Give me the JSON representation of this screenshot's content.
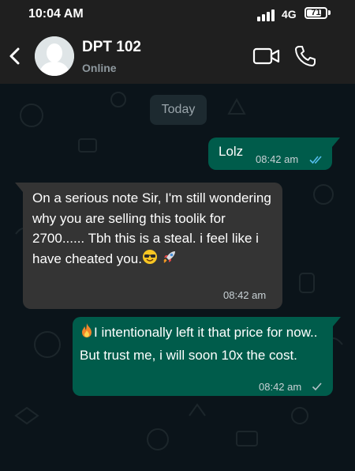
{
  "status_bar": {
    "time": "10:04 AM",
    "network": "4G",
    "battery": "71"
  },
  "header": {
    "contact_name": "DPT 102",
    "contact_status": "Online",
    "icons": [
      "back-arrow-icon",
      "avatar-placeholder",
      "video-call-icon",
      "phone-call-icon"
    ]
  },
  "chat": {
    "date_label": "Today",
    "messages": [
      {
        "direction": "outgoing",
        "text": "Lolz",
        "time": "08:42 am",
        "status": "read"
      },
      {
        "direction": "incoming",
        "text": " On a serious note Sir, I'm still wondering why you are selling this toolik for 2700...... Tbh this is a steal. i feel like i have cheated you.",
        "emojis": [
          "sunglasses-smile-emoji",
          "rocket-emoji"
        ],
        "time": "08:42 am"
      },
      {
        "direction": "outgoing",
        "text": "I intentionally left it that price for now.. But trust me, i will soon 10x the cost.",
        "emojis": [
          "fire-emoji"
        ],
        "time": "08:42 am",
        "status": "delivered"
      }
    ]
  },
  "colors": {
    "header_bg": "#1f1f1f",
    "chat_bg": "#0b141a",
    "outgoing_bubble": "#005c4b",
    "incoming_bubble": "#343434",
    "read_tick": "#53bdeb"
  }
}
